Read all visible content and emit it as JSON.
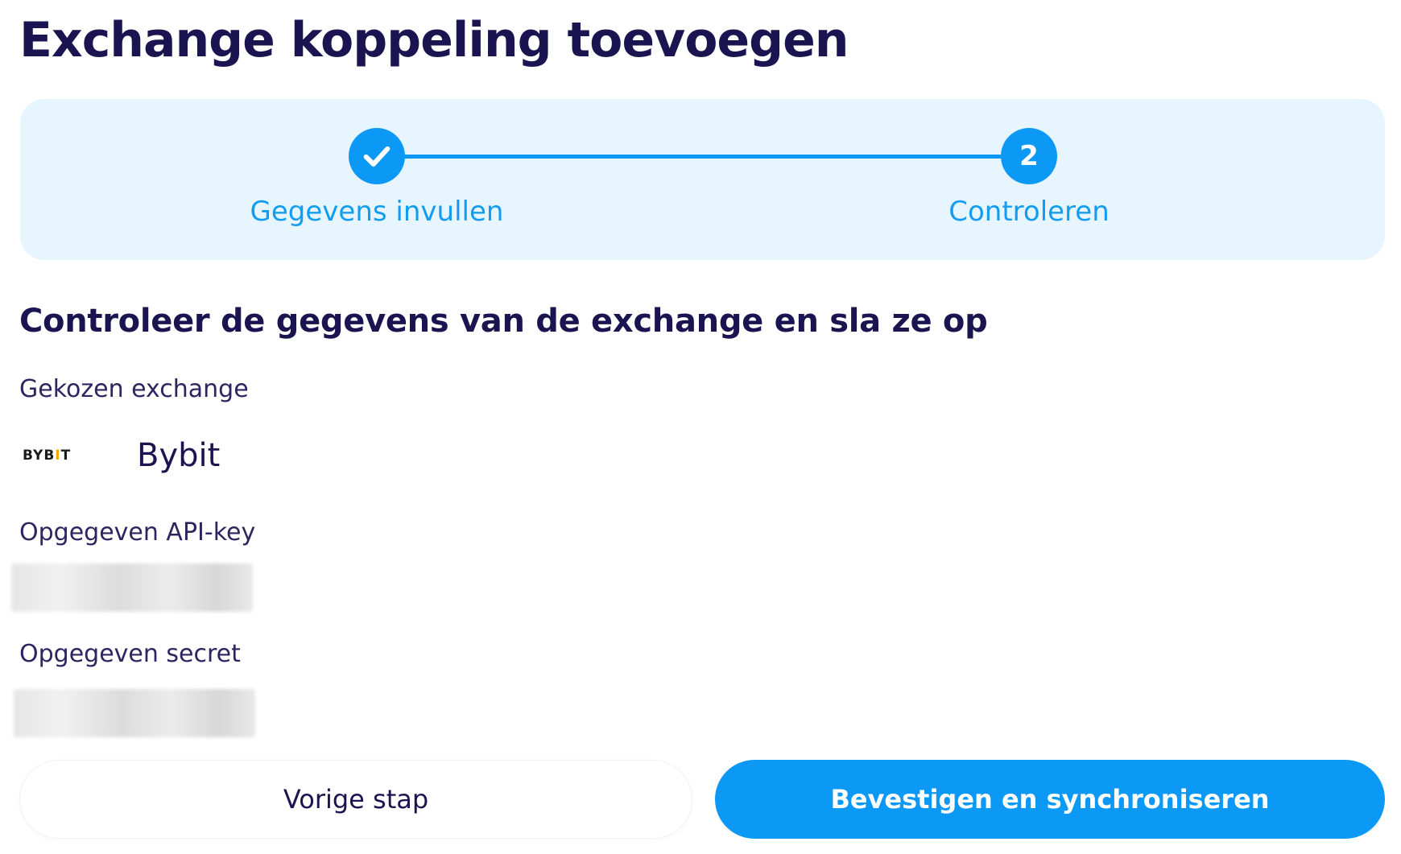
{
  "header": {
    "title": "Exchange koppeling toevoegen"
  },
  "stepper": {
    "steps": [
      {
        "label": "Gegevens invullen",
        "state": "done",
        "icon": "check-icon"
      },
      {
        "label": "Controleren",
        "state": "current",
        "number": "2"
      }
    ],
    "accent_color": "#0b99f5",
    "background_color": "#e6f5ff"
  },
  "review": {
    "title": "Controleer de gegevens van de exchange en sla ze op",
    "exchange_label": "Gekozen exchange",
    "exchange_logo_text": "BYBIT",
    "exchange_name": "Bybit",
    "apikey_label": "Opgegeven API-key",
    "secret_label": "Opgegeven secret"
  },
  "actions": {
    "back_label": "Vorige stap",
    "confirm_label": "Bevestigen en synchroniseren"
  }
}
